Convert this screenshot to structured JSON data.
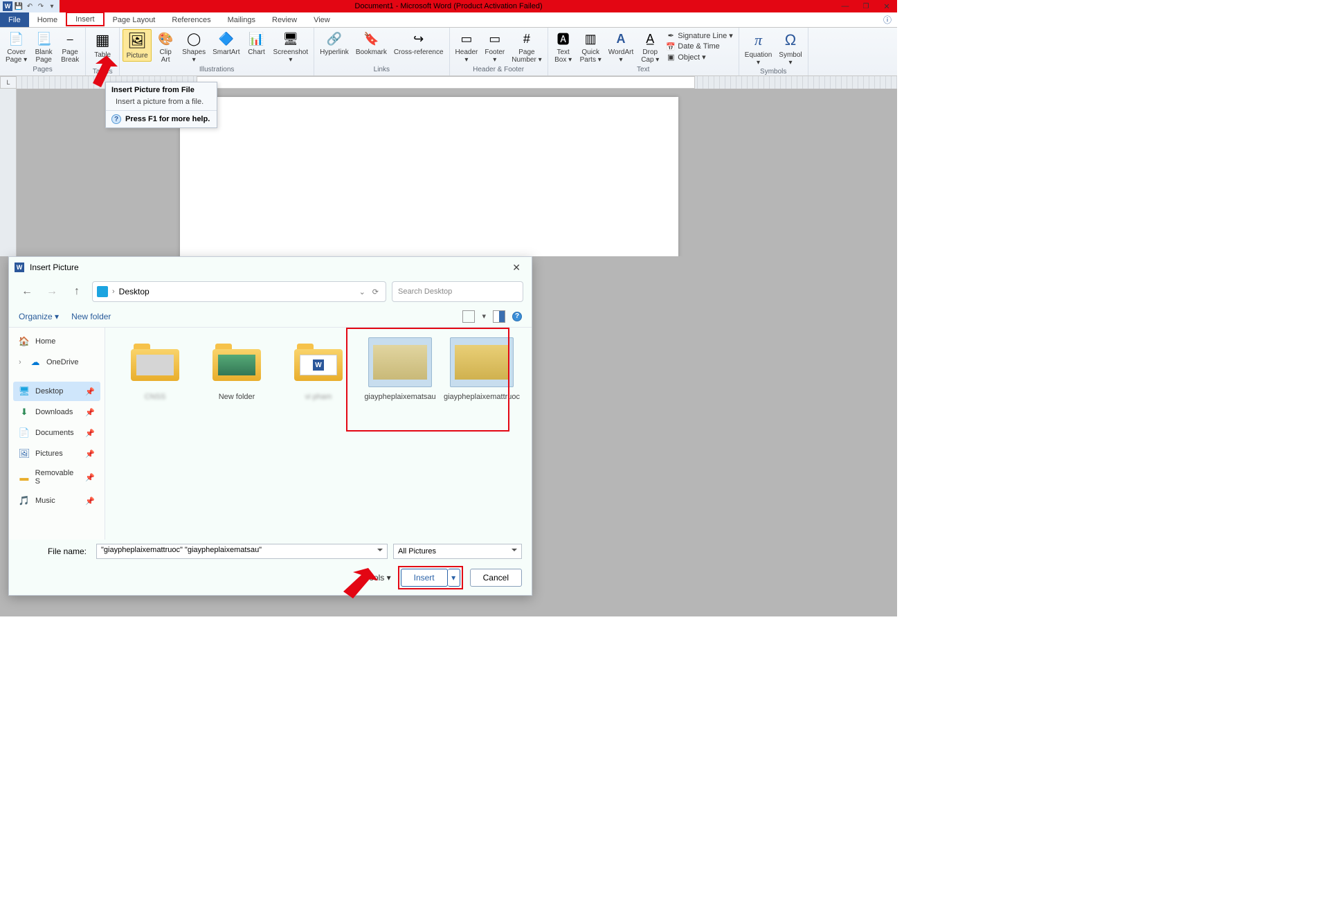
{
  "title": "Document1 - Microsoft Word (Product Activation Failed)",
  "window": {
    "min": "—",
    "max": "❐",
    "close": "✕"
  },
  "tabs": {
    "file": "File",
    "home": "Home",
    "insert": "Insert",
    "pagelayout": "Page Layout",
    "references": "References",
    "mailings": "Mailings",
    "review": "Review",
    "view": "View"
  },
  "ribbon": {
    "pages": {
      "label": "Pages",
      "cover": "Cover\nPage ▾",
      "blank": "Blank\nPage",
      "break": "Page\nBreak"
    },
    "tables": {
      "label": "Tables",
      "table": "Table\n▾"
    },
    "illustrations": {
      "label": "Illustrations",
      "picture": "Picture",
      "clipart": "Clip\nArt",
      "shapes": "Shapes\n▾",
      "smartart": "SmartArt",
      "chart": "Chart",
      "screenshot": "Screenshot\n▾"
    },
    "links": {
      "label": "Links",
      "hyperlink": "Hyperlink",
      "bookmark": "Bookmark",
      "crossref": "Cross-reference"
    },
    "hf": {
      "label": "Header & Footer",
      "header": "Header\n▾",
      "footer": "Footer\n▾",
      "pagenum": "Page\nNumber ▾"
    },
    "text": {
      "label": "Text",
      "textbox": "Text\nBox ▾",
      "quick": "Quick\nParts ▾",
      "wordart": "WordArt\n▾",
      "dropcap": "Drop\nCap ▾",
      "sig": "Signature Line ▾",
      "date": "Date & Time",
      "obj": "Object ▾"
    },
    "symbols": {
      "label": "Symbols",
      "eq": "Equation\n▾",
      "sym": "Symbol\n▾"
    }
  },
  "tooltip": {
    "title": "Insert Picture from File",
    "body": "Insert a picture from a file.",
    "help": "Press F1 for more help."
  },
  "dialog": {
    "title": "Insert Picture",
    "location": "Desktop",
    "search": "Search Desktop",
    "organize": "Organize ▾",
    "newfolder": "New folder",
    "side": {
      "home": "Home",
      "onedrive": "OneDrive",
      "desktop": "Desktop",
      "downloads": "Downloads",
      "documents": "Documents",
      "pictures": "Pictures",
      "removable": "Removable S",
      "music": "Music"
    },
    "items": {
      "f1": "CNSS",
      "f2": "New folder",
      "f3": "vi pham",
      "i1": "giaypheplaixematsau",
      "i2": "giaypheplaixemattruoc"
    },
    "filename_label": "File name:",
    "filename_value": "\"giaypheplaixemattruoc\" \"giaypheplaixematsau\"",
    "filter": "All Pictures",
    "tools": "Tools   ▾",
    "insert_btn": "Insert",
    "cancel_btn": "Cancel"
  }
}
